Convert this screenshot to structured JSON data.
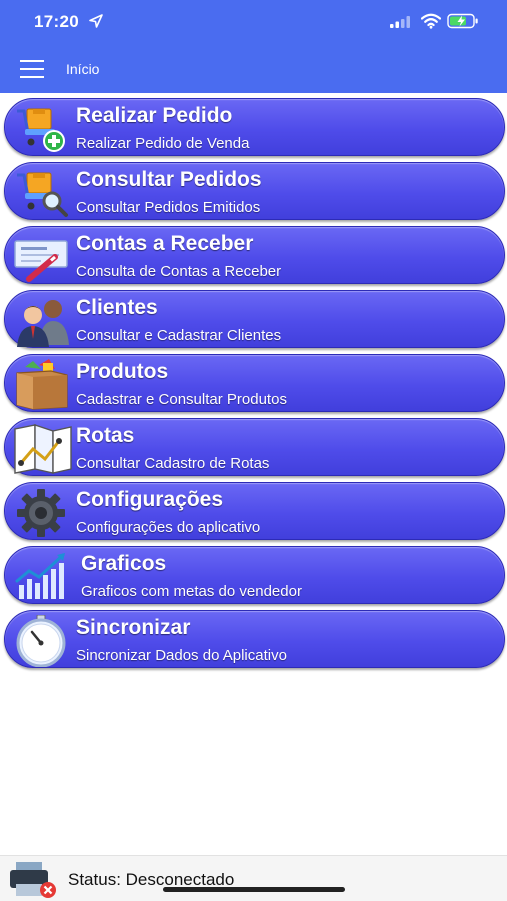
{
  "status_bar": {
    "time": "17:20"
  },
  "navbar": {
    "title": "Início"
  },
  "menu": [
    {
      "title": "Realizar Pedido",
      "subtitle": "Realizar Pedido de Venda",
      "icon": "cart-add-icon"
    },
    {
      "title": "Consultar Pedidos",
      "subtitle": "Consultar Pedidos Emitidos",
      "icon": "cart-search-icon"
    },
    {
      "title": "Contas a Receber",
      "subtitle": "Consulta de Contas a Receber",
      "icon": "check-pen-icon"
    },
    {
      "title": "Clientes",
      "subtitle": "Consultar e Cadastrar Clientes",
      "icon": "clients-icon"
    },
    {
      "title": "Produtos",
      "subtitle": "Cadastrar e Consultar Produtos",
      "icon": "products-box-icon"
    },
    {
      "title": "Rotas",
      "subtitle": "Consultar Cadastro de Rotas",
      "icon": "route-map-icon"
    },
    {
      "title": "Configurações",
      "subtitle": "Configurações do aplicativo",
      "icon": "gear-icon"
    },
    {
      "title": "Graficos",
      "subtitle": "Graficos com metas do vendedor",
      "icon": "bar-chart-icon"
    },
    {
      "title": "Sincronizar",
      "subtitle": "Sincronizar Dados do Aplicativo",
      "icon": "stopwatch-icon"
    }
  ],
  "footer": {
    "status": "Status: Desconectado",
    "icon": "printer-disconnected-icon"
  },
  "colors": {
    "header": "#4a6cf0",
    "button_top": "#6a68f4",
    "button_bottom": "#413fdc",
    "button_border": "#2d2bb6"
  }
}
